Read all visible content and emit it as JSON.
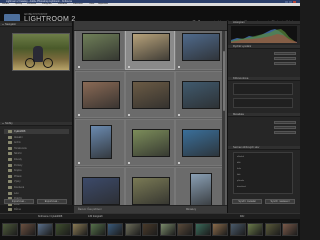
{
  "window": {
    "title": "Lightroom 2 Catalog - Adobe Photoshop Lightroom - Knihovna",
    "menus": [
      "Soubor",
      "Úpravy",
      "Knihovna",
      "Fotografie",
      "Metadata",
      "Zobrazení",
      "Okno",
      "Nápověda"
    ]
  },
  "identity": {
    "subtitle": "ADOBE PHOTOSHOP",
    "product": "LIGHTROOM 2"
  },
  "modules": [
    {
      "label": "Knihovna",
      "active": true
    },
    {
      "label": "Vyvolávání",
      "active": false
    },
    {
      "label": "Prezentace",
      "active": false
    },
    {
      "label": "Tisk",
      "active": false
    },
    {
      "label": "Web",
      "active": false
    }
  ],
  "left_panel": {
    "navigator_title": "Navigátor",
    "folders_title": "Složky",
    "folders": [
      {
        "label": "Cyklo2008",
        "selected": true
      },
      {
        "label": "Aktuální",
        "selected": false
      },
      {
        "label": "Archiv",
        "selected": false
      },
      {
        "label": "Horská kola",
        "selected": false
      },
      {
        "label": "Silniční",
        "selected": false
      },
      {
        "label": "Závody",
        "selected": false
      },
      {
        "label": "Portréty",
        "selected": false
      },
      {
        "label": "Krajina",
        "selected": false
      },
      {
        "label": "Přátelé",
        "selected": false
      },
      {
        "label": "Výlety",
        "selected": false
      },
      {
        "label": "Dovolená",
        "selected": false
      },
      {
        "label": "Léto",
        "selected": false
      },
      {
        "label": "Podzim",
        "selected": false
      },
      {
        "label": "Zima",
        "selected": false
      },
      {
        "label": "Různé",
        "selected": false
      }
    ],
    "import_label": "Importovat...",
    "export_label": "Exportovat..."
  },
  "right_panel": {
    "histogram_title": "Histogram",
    "quick_develop_title": "Rychlé vyvolání",
    "keywording_title": "Klíčová slova",
    "keyword_list_title": "Seznam klíčových slov",
    "metadata_title": "Metadata",
    "keywords": [
      "alkohol",
      "děti",
      "kolo",
      "lidé",
      "příroda",
      "dovolená"
    ],
    "sync_meta_label": "Synchr. metadat",
    "sync_set_label": "Synchr. nastavení"
  },
  "toolbar": {
    "sort_label": "Řazení: Čas pořízení",
    "thumbs_label": "Miniatury"
  },
  "filmstrip": {
    "breadcrumb": "Knihovna / Cyklo2008",
    "count_label": "130 fotografií",
    "filter_label": "Filtr:"
  },
  "colors": {
    "accent": "#4d6f9c",
    "panel": "#262626",
    "grid": "#5e5e5e"
  }
}
